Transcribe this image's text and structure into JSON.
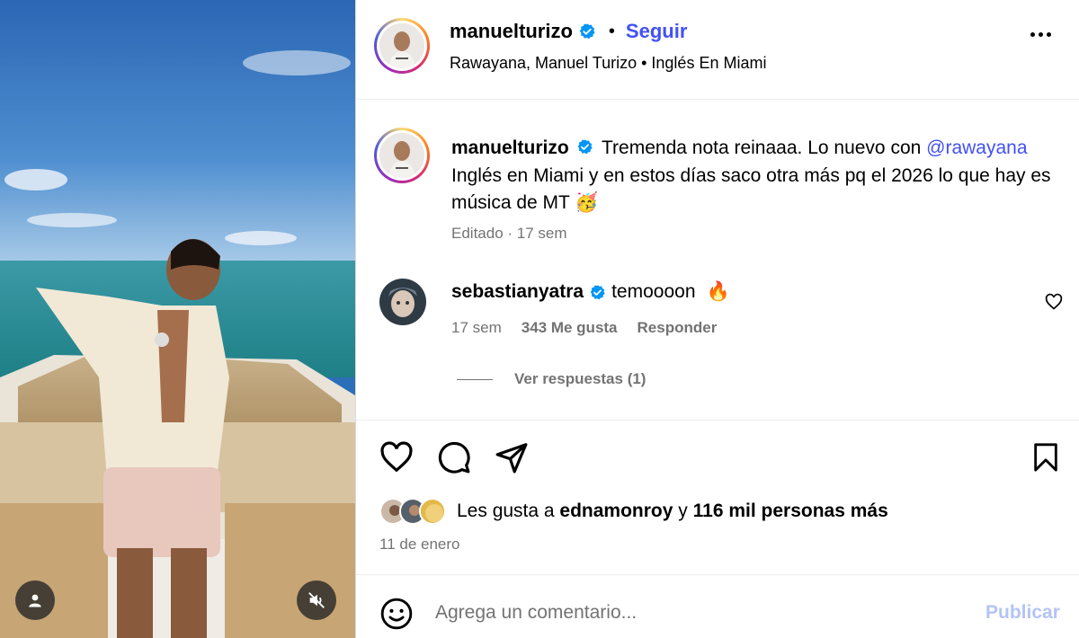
{
  "post": {
    "author": "manuelturizo",
    "follow_label": "Seguir",
    "dot": "•",
    "audio_line": "Rawayana, Manuel Turizo • Inglés En Miami"
  },
  "caption": {
    "username": "manuelturizo",
    "text_before": "Tremenda nota reinaaa. Lo nuevo con ",
    "mention": "@rawayana",
    "text_after": " Inglés en Miami y en estos días saco otra más pq el 2026 lo que hay es música de MT ",
    "emoji": "🥳",
    "meta": "Editado · 17 sem"
  },
  "comment": {
    "username": "sebastianyatra",
    "text": "temoooon",
    "emoji": "🔥",
    "time": "17 sem",
    "likes": "343 Me gusta",
    "reply_label": "Responder",
    "view_replies": "Ver respuestas (1)"
  },
  "likes": {
    "prefix": "Les gusta a ",
    "user": "ednamonroy",
    "middle": " y ",
    "count": "116 mil personas más"
  },
  "date": "11 de enero",
  "composer": {
    "placeholder": "Agrega un comentario...",
    "publish_label": "Publicar"
  },
  "icons": {
    "header_menu": "more-icon",
    "like": "heart-icon",
    "comment": "comment-icon",
    "share": "share-icon",
    "save": "bookmark-icon",
    "emoji": "emoji-icon",
    "tag": "user-icon",
    "mute": "muted-speaker-icon"
  },
  "colors": {
    "link": "#4150f7",
    "muted": "#737373",
    "verified": "#0095f6",
    "publish_disabled": "#b3c4f5"
  }
}
